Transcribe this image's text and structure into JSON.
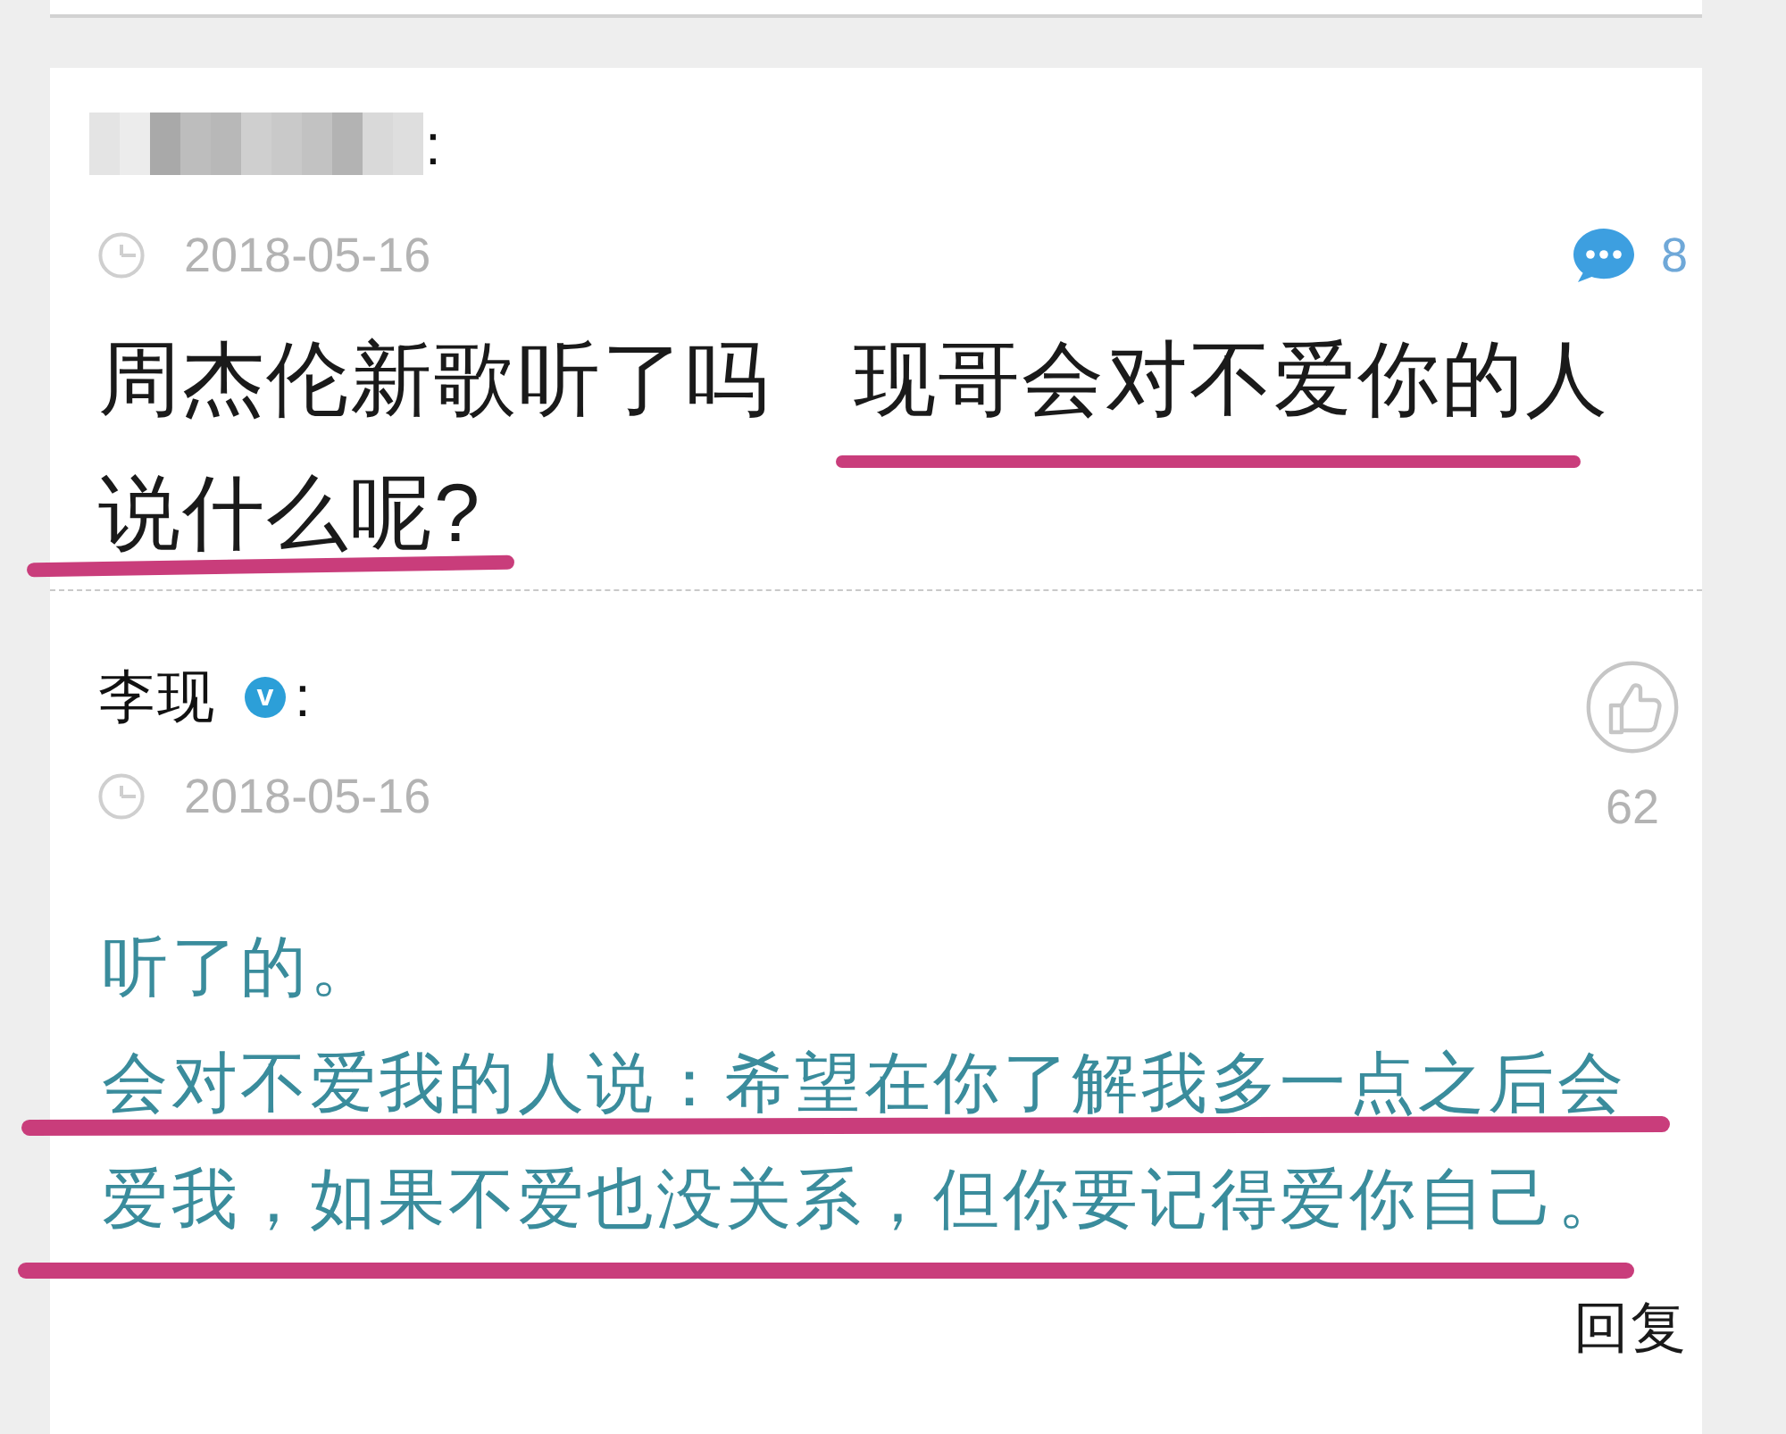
{
  "question": {
    "author": {
      "kind": "blurred",
      "separator": ":"
    },
    "date": "2018-05-16",
    "comment_count": "8",
    "text": "周杰伦新歌听了吗　现哥会对不爱你的人说什么呢?",
    "underlined": true
  },
  "answer": {
    "author": {
      "kind": "verified",
      "name": "李现",
      "badge": "v",
      "separator": ":"
    },
    "date": "2018-05-16",
    "like_count": "62",
    "paragraphs": [
      {
        "text": "听了的。",
        "underlined": false
      },
      {
        "text": "会对不爱我的人说：希望在你了解我多一点之后会爱我，如果不爱也没关系，但你要记得爱你自己。",
        "underlined": true
      }
    ],
    "reply_label": "回复"
  }
}
